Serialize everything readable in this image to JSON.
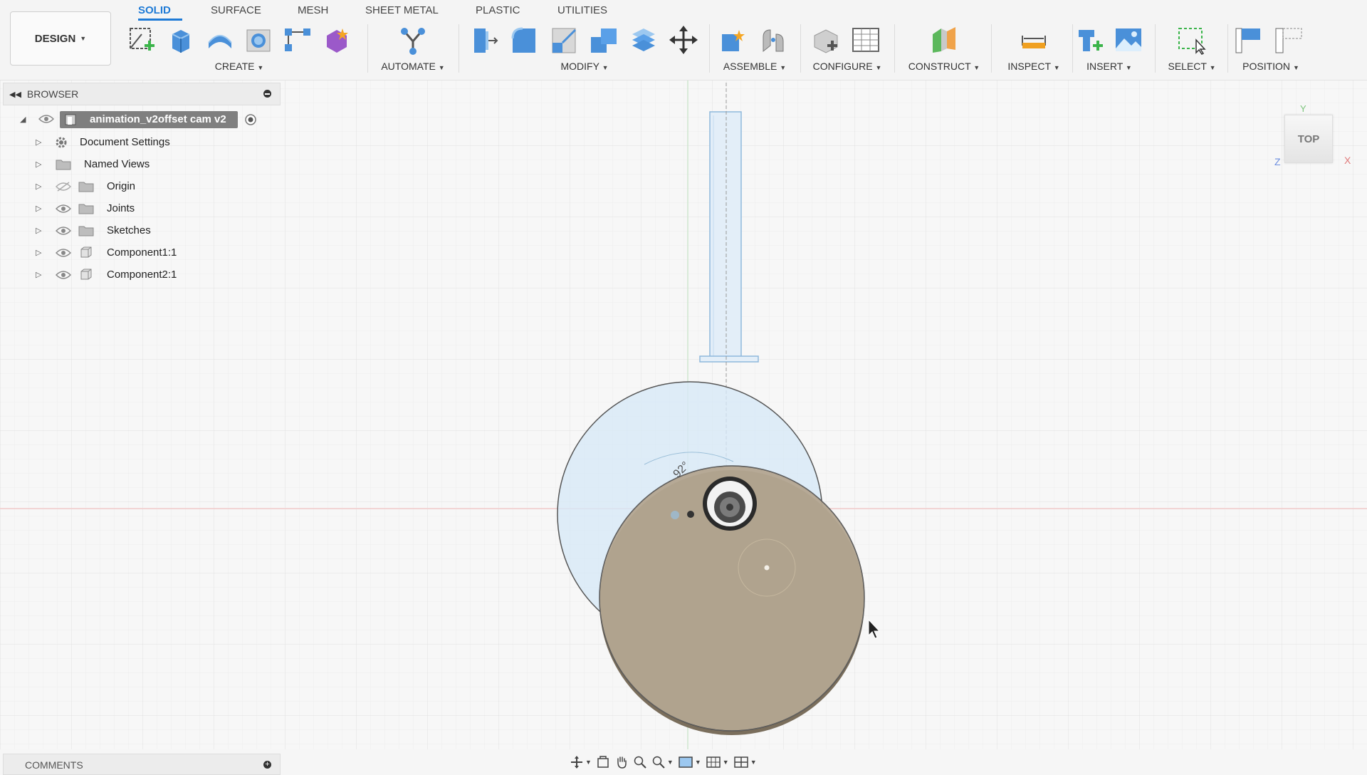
{
  "design_menu": {
    "label": "DESIGN"
  },
  "tabs": [
    {
      "label": "SOLID",
      "active": true
    },
    {
      "label": "SURFACE"
    },
    {
      "label": "MESH"
    },
    {
      "label": "SHEET METAL"
    },
    {
      "label": "PLASTIC"
    },
    {
      "label": "UTILITIES"
    }
  ],
  "groups": {
    "create": "CREATE",
    "automate": "AUTOMATE",
    "modify": "MODIFY",
    "assemble": "ASSEMBLE",
    "configure": "CONFIGURE",
    "construct": "CONSTRUCT",
    "inspect": "INSPECT",
    "insert": "INSERT",
    "select": "SELECT",
    "position": "POSITION"
  },
  "browser": {
    "title": "BROWSER",
    "root": "animation_v2offset cam v2",
    "items": [
      {
        "label": "Document Settings",
        "icon": "gear-icon"
      },
      {
        "label": "Named Views",
        "icon": "folder-icon"
      },
      {
        "label": "Origin",
        "icon": "folder-icon",
        "hidden": true
      },
      {
        "label": "Joints",
        "icon": "folder-icon"
      },
      {
        "label": "Sketches",
        "icon": "folder-icon"
      },
      {
        "label": "Component1:1",
        "icon": "component-icon"
      },
      {
        "label": "Component2:1",
        "icon": "component-icon"
      }
    ]
  },
  "viewport": {
    "angle_label": "92°"
  },
  "viewcube": {
    "face": "TOP",
    "axis_y": "Y",
    "axis_x": "X",
    "axis_z": "Z"
  },
  "comments": {
    "title": "COMMENTS"
  },
  "colors": {
    "accent": "#1e7ad6",
    "cam_disk": "#b3a590",
    "ghost_blue": "#d7e9f6"
  }
}
